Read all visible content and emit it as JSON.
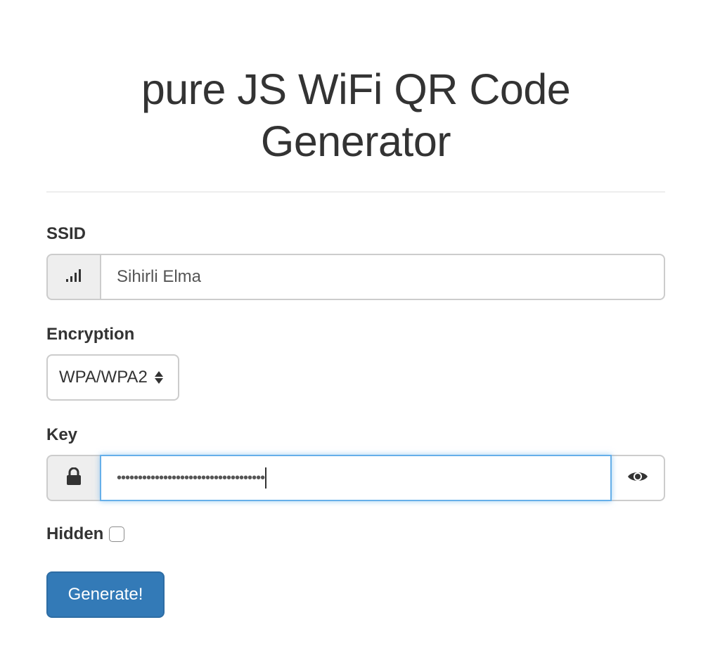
{
  "header": {
    "title_line1": "pure JS WiFi QR Code",
    "title_line2": "Generator"
  },
  "form": {
    "ssid": {
      "label": "SSID",
      "value": "Sihirli Elma",
      "icon": "signal-icon"
    },
    "encryption": {
      "label": "Encryption",
      "selected": "WPA/WPA2"
    },
    "key": {
      "label": "Key",
      "masked_value": "•••••••••••••••••••••••••••••••••••",
      "lock_icon": "lock-icon",
      "reveal_icon": "eye-icon"
    },
    "hidden": {
      "label": "Hidden",
      "checked": false
    },
    "generate_label": "Generate!"
  },
  "colors": {
    "primary": "#337ab7",
    "focus": "#66afe9",
    "text": "#333333"
  }
}
